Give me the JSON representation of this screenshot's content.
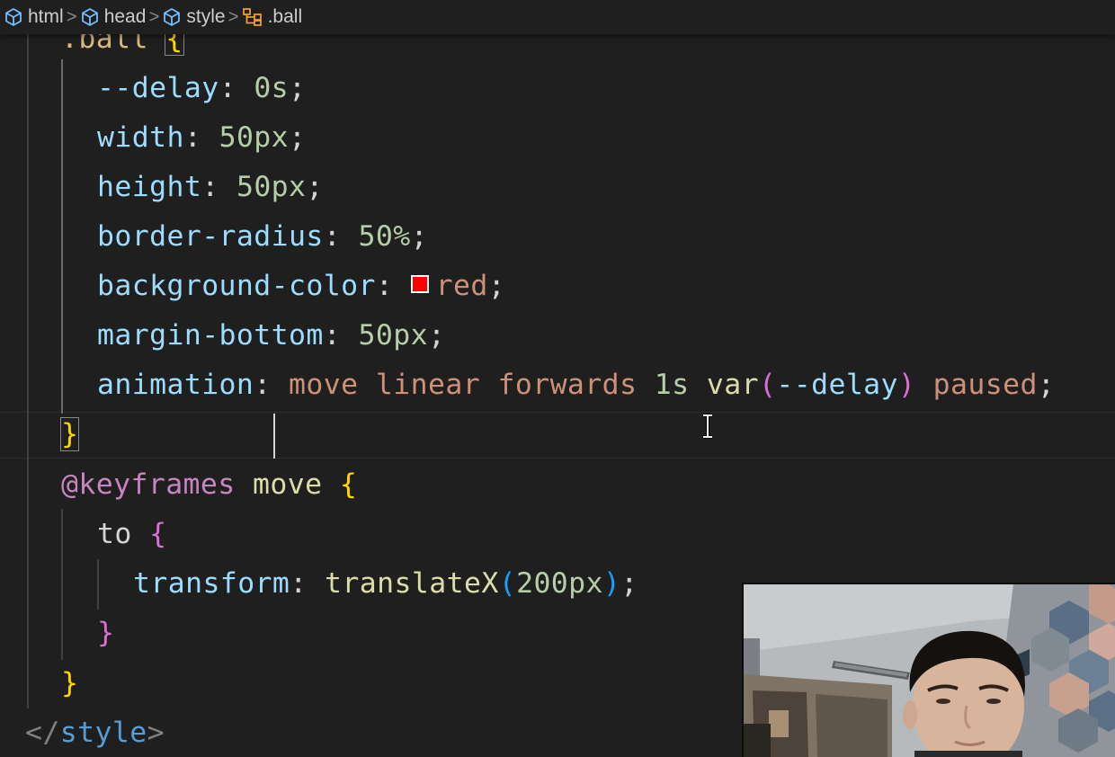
{
  "breadcrumb": {
    "items": [
      {
        "label": "html",
        "icon": "cube-icon"
      },
      {
        "label": "head",
        "icon": "cube-icon"
      },
      {
        "label": "style",
        "icon": "cube-icon"
      },
      {
        "label": ".ball",
        "icon": "selector-icon"
      }
    ],
    "separator": ">"
  },
  "code": {
    "l0": {
      "selector": ".ball",
      "brace": "{"
    },
    "l1": {
      "prop": "--delay",
      "colon": ":",
      "value": "0s",
      "semi": ";"
    },
    "l2": {
      "prop": "width",
      "colon": ":",
      "value": "50px",
      "semi": ";"
    },
    "l3": {
      "prop": "height",
      "colon": ":",
      "value": "50px",
      "semi": ";"
    },
    "l4": {
      "prop": "border-radius",
      "colon": ":",
      "value": "50%",
      "semi": ";"
    },
    "l5": {
      "prop": "background-color",
      "colon": ":",
      "value": "red",
      "semi": ";"
    },
    "l6": {
      "prop": "margin-bottom",
      "colon": ":",
      "value": "50px",
      "semi": ";"
    },
    "l7": {
      "prop": "animation",
      "colon": ":",
      "v1": "move",
      "v2": "linear",
      "v3": "forwards",
      "v4": "1s",
      "fn": "var",
      "paren_open": "(",
      "arg": "--delay",
      "paren_close": ")",
      "v5": "paused",
      "semi": ";"
    },
    "l8": {
      "brace": "}"
    },
    "l9": {
      "keyword": "@keyframes",
      "name": "move",
      "brace": "{"
    },
    "l10": {
      "selector": "to",
      "brace": "{"
    },
    "l11": {
      "prop": "transform",
      "colon": ":",
      "fn": "translateX",
      "paren_open": "(",
      "arg": "200px",
      "paren_close": ")",
      "semi": ";"
    },
    "l12": {
      "brace": "}"
    },
    "l13": {
      "brace": "}"
    },
    "l14": {
      "open": "</",
      "tag": "style",
      "close": ">"
    }
  },
  "colors": {
    "editor_bg": "#1f1f1f",
    "property": "#9cdcfe",
    "number": "#b5cea8",
    "string_value": "#ce9178",
    "function": "#dcdcaa",
    "bracket_level1": "#ffd700",
    "bracket_level2": "#da70d6",
    "bracket_level3": "#179fff",
    "selector": "#d7ba7d",
    "at_rule": "#c586c0",
    "tag": "#569cd6",
    "color_swatch": "#ff0000"
  },
  "webcam": {
    "icon": "webcam-feed"
  }
}
